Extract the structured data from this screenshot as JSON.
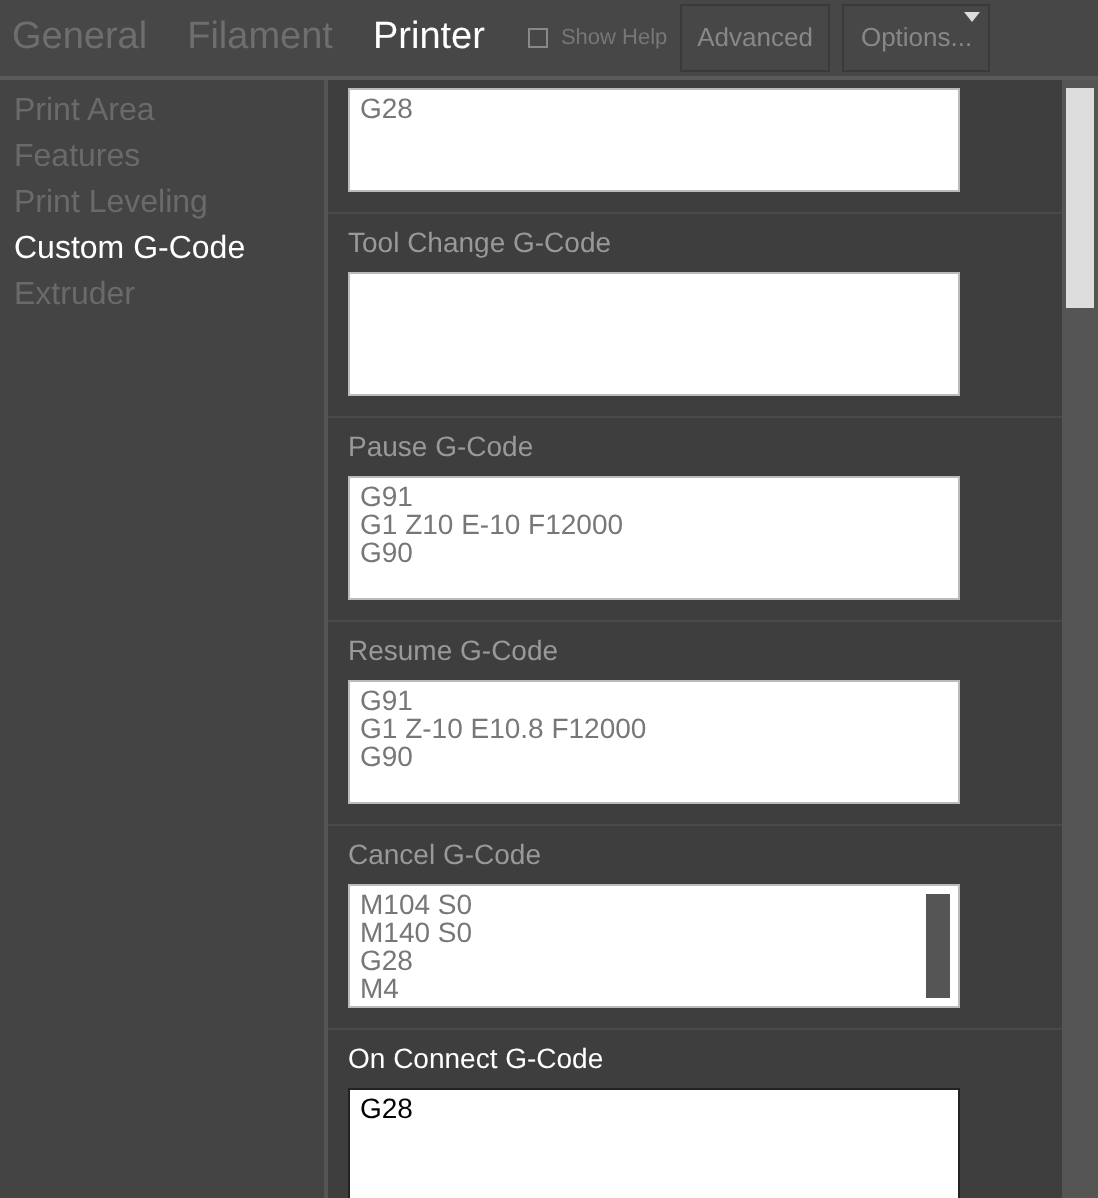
{
  "tabs": [
    {
      "label": "General",
      "selected": false
    },
    {
      "label": "Filament",
      "selected": false
    },
    {
      "label": "Printer",
      "selected": true
    }
  ],
  "show_help": {
    "label": "Show Help",
    "checked": false
  },
  "buttons": [
    {
      "label": "Advanced",
      "kind": "plain"
    },
    {
      "label": "Options...",
      "kind": "menu"
    }
  ],
  "sidebar": {
    "items": [
      {
        "label": "Print Area",
        "selected": false
      },
      {
        "label": "Features",
        "selected": false
      },
      {
        "label": "Print Leveling",
        "selected": false
      },
      {
        "label": "Custom G-Code",
        "selected": true
      },
      {
        "label": "Extruder",
        "selected": false
      }
    ]
  },
  "sections": [
    {
      "lines": [
        "G28"
      ],
      "focused": false,
      "scrollable": false
    },
    {
      "label": "Tool Change G-Code",
      "focused": false,
      "scrollable": false
    },
    {
      "label": "Pause G-Code",
      "lines": [
        "G91",
        "G1 Z10 E-10 F12000",
        "G90"
      ],
      "focused": false,
      "scrollable": false
    },
    {
      "label": "Resume G-Code",
      "lines": [
        "G91",
        "G1 Z-10 E10.8 F12000",
        "G90"
      ],
      "focused": false,
      "scrollable": false
    },
    {
      "label": "Cancel G-Code",
      "lines": [
        "M104 S0",
        "M140 S0",
        "G28",
        "M4"
      ],
      "focused": false,
      "scrollable": true
    },
    {
      "label": "On Connect G-Code",
      "lines": [
        "G28"
      ],
      "focused": true,
      "scrollable": false
    }
  ]
}
